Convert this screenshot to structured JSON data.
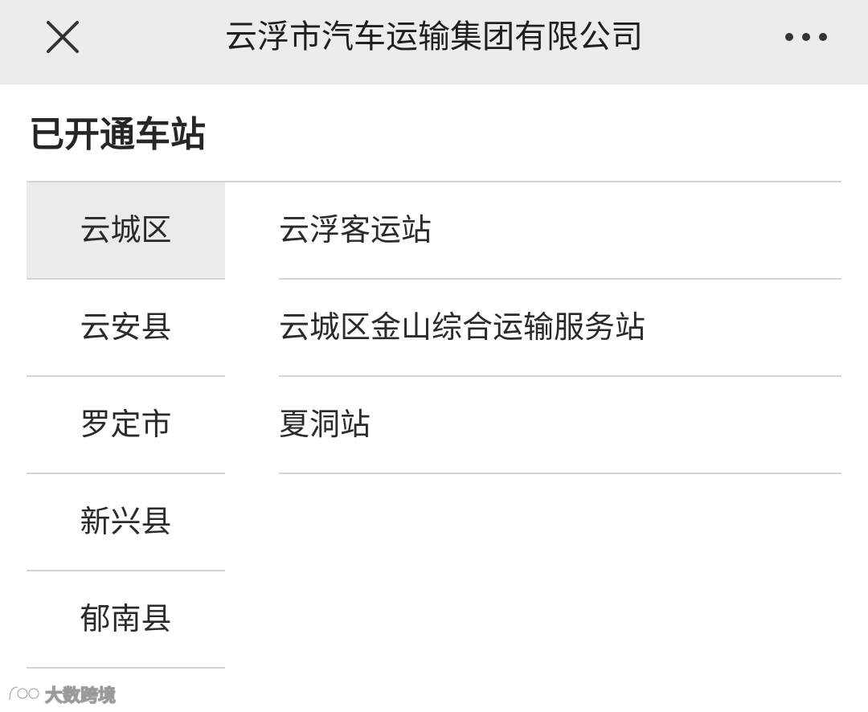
{
  "header": {
    "title": "云浮市汽车运输集团有限公司",
    "close_icon": "close-icon",
    "more_icon": "more-dots-icon"
  },
  "section": {
    "title": "已开通车站"
  },
  "districts": [
    {
      "label": "云城区",
      "selected": true
    },
    {
      "label": "云安县",
      "selected": false
    },
    {
      "label": "罗定市",
      "selected": false
    },
    {
      "label": "新兴县",
      "selected": false
    },
    {
      "label": "郁南县",
      "selected": false
    }
  ],
  "stations": [
    {
      "label": "云浮客运站"
    },
    {
      "label": "云城区金山综合运输服务站"
    },
    {
      "label": "夏洞站"
    }
  ],
  "watermark": {
    "text": "大数跨境"
  },
  "colors": {
    "topbar_bg": "#ececec",
    "selected_bg": "#ebebeb",
    "divider": "#d4d4d4",
    "text": "#2a2a2a"
  }
}
